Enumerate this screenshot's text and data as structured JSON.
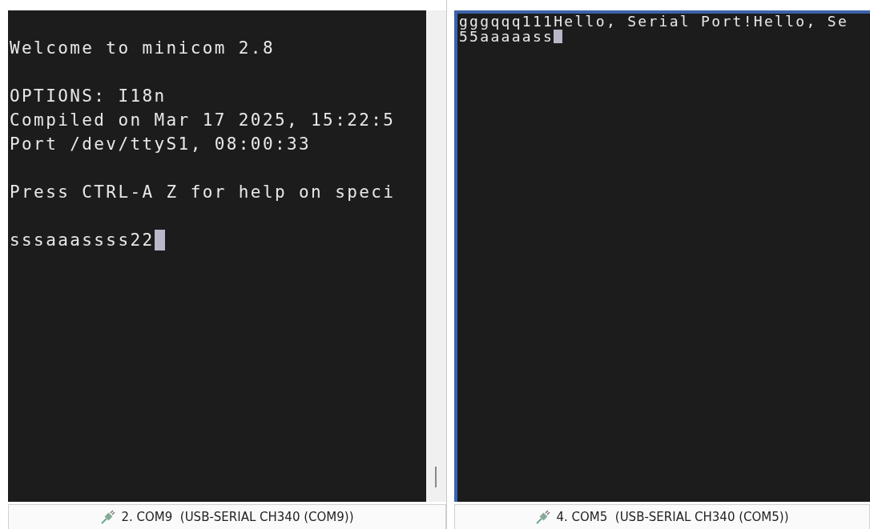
{
  "panes": [
    {
      "selected": false,
      "scrollbar": true,
      "cursor": true,
      "paragraphs": [
        [
          "Welcome to minicom 2.8"
        ],
        [
          "OPTIONS: I18n",
          "Compiled on Mar 17 2025, 15:22:5",
          "Port /dev/ttyS1, 08:00:33"
        ],
        [
          "Press CTRL-A Z for help on speci"
        ],
        [
          "sssaaassss22"
        ]
      ],
      "tab": "2. COM9  (USB-SERIAL CH340 (COM9))"
    },
    {
      "selected": true,
      "scrollbar": false,
      "cursor": true,
      "paragraphs": [
        [
          "gggqqq111Hello, Serial Port!Hello, Se",
          "55aaaaass"
        ]
      ],
      "tab": "4. COM5  (USB-SERIAL CH340 (COM5))"
    }
  ]
}
